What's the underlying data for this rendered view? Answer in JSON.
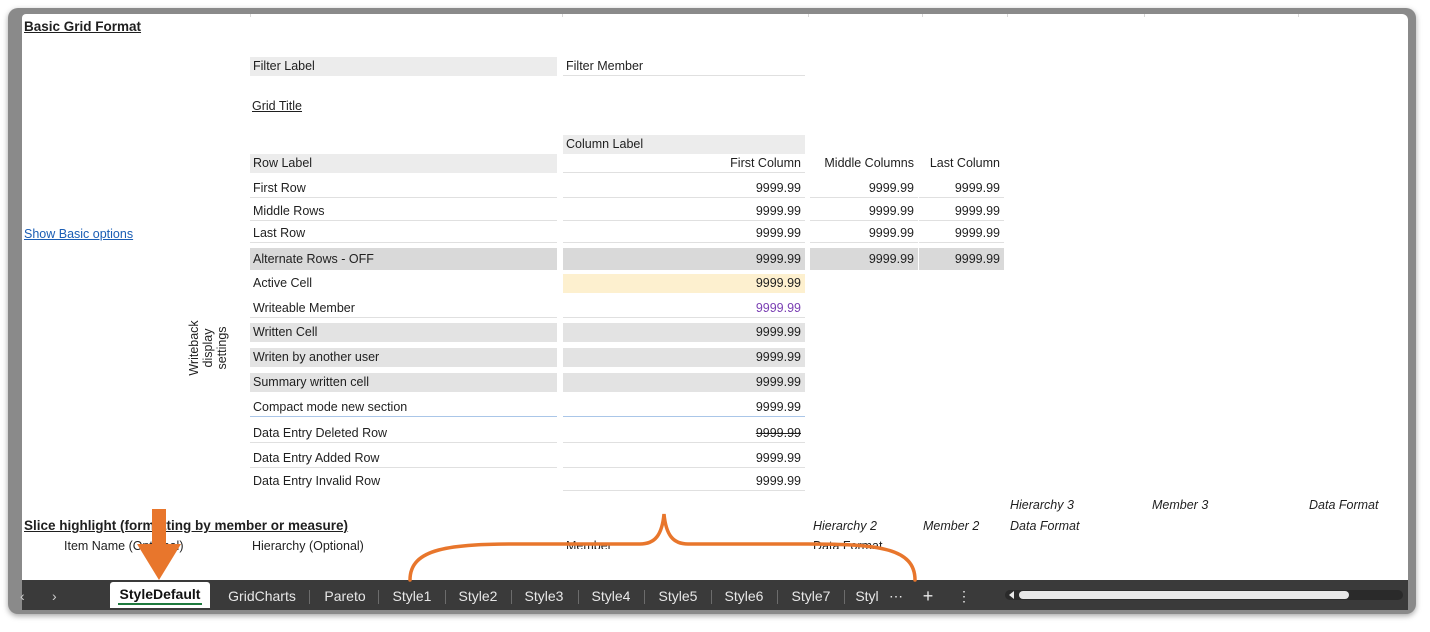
{
  "sheet": {
    "title": "Basic Grid Format",
    "show_basic_options": "Show Basic options",
    "filter_label": "Filter Label",
    "filter_member": "Filter Member",
    "grid_title": "Grid Title",
    "column_label": "Column Label",
    "row_label": "Row Label",
    "columns": [
      "First Column",
      "Middle Columns",
      "Last Column"
    ],
    "rows": [
      {
        "label": "First Row",
        "values": [
          "9999.99",
          "9999.99",
          "9999.99"
        ]
      },
      {
        "label": "Middle Rows",
        "values": [
          "9999.99",
          "9999.99",
          "9999.99"
        ]
      },
      {
        "label": "Last Row",
        "values": [
          "9999.99",
          "9999.99",
          "9999.99"
        ]
      },
      {
        "label": "Alternate Rows - OFF",
        "values": [
          "9999.99",
          "9999.99",
          "9999.99"
        ]
      }
    ],
    "writeback_label": [
      "Writeback",
      "display",
      "settings"
    ],
    "writeback_rows": [
      {
        "label": "Active Cell",
        "value": "9999.99"
      },
      {
        "label": "Writeable Member",
        "value": "9999.99"
      },
      {
        "label": "Written Cell",
        "value": "9999.99"
      },
      {
        "label": "Writen by another user",
        "value": "9999.99"
      },
      {
        "label": "Summary written cell",
        "value": "9999.99"
      },
      {
        "label": "Compact mode new section",
        "value": "9999.99"
      },
      {
        "label": "Data Entry Deleted Row",
        "value": "9999.99"
      },
      {
        "label": "Data Entry Added Row",
        "value": "9999.99"
      },
      {
        "label": "Data Entry Invalid Row",
        "value": "9999.99"
      }
    ],
    "slice": {
      "title": "Slice highlight (formatting by member or measure)",
      "item_name": "Item Name (Optional)",
      "hierarchy_optional": "Hierarchy (Optional)",
      "member": "Member",
      "data_format_partial": "Data Format",
      "hierarchy2": "Hierarchy 2",
      "member2": "Member 2",
      "data_format2": "Data Format",
      "hierarchy3": "Hierarchy 3",
      "member3": "Member 3",
      "data_format3": "Data Format"
    }
  },
  "tabs": [
    "StyleDefault",
    "GridCharts",
    "Pareto",
    "Style1",
    "Style2",
    "Style3",
    "Style4",
    "Style5",
    "Style6",
    "Style7",
    "Styl"
  ],
  "tab_overflow": "⋯",
  "tab_add": "+",
  "tab_menu": "⋮",
  "nav_prev": "‹",
  "nav_next": "›",
  "colors": {
    "annotation": "#e8762c",
    "link": "#1a5db4",
    "active_cell": "#fdf0cf",
    "writeable": "#7a3fb3",
    "tab_bar": "#3a3a3a"
  }
}
